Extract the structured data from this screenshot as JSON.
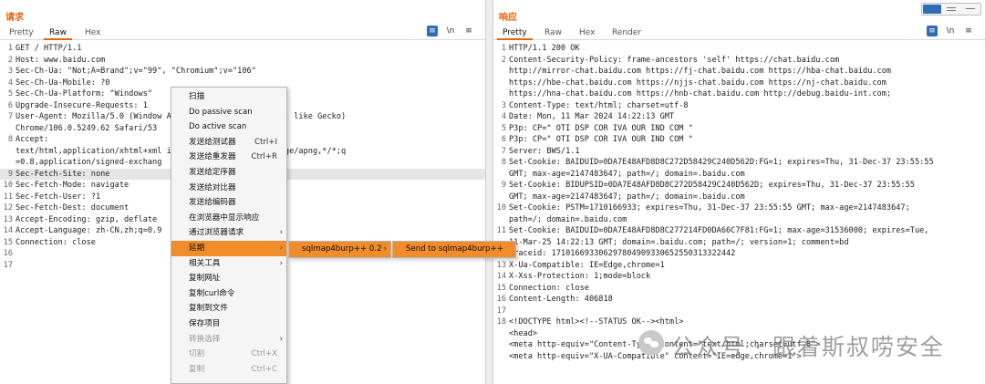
{
  "request": {
    "title": "请求",
    "tabs": [
      "Pretty",
      "Raw",
      "Hex"
    ],
    "active_tab": "Raw",
    "icons": [
      "wrap-icon",
      "newline-icon",
      "menu-icon"
    ],
    "icon_glyphs": [
      "≡",
      "\\n",
      "≡"
    ],
    "lines": [
      [
        "1",
        "GET / HTTP/1.1"
      ],
      [
        "2",
        "Host: www.baidu.com"
      ],
      [
        "3",
        "Sec-Ch-Ua: \"Not;A=Brand\";v=\"99\", \"Chromium\";v=\"106\""
      ],
      [
        "4",
        "Sec-Ch-Ua-Mobile: ?0"
      ],
      [
        "5",
        "Sec-Ch-Ua-Platform: \"Windows\""
      ],
      [
        "6",
        "Upgrade-Insecure-Requests: 1"
      ],
      [
        "7",
        "User-Agent: Mozilla/5.0 (Window                      AppleWebKit/537.36 (KHTML, like Gecko)"
      ],
      [
        "",
        " Chrome/106.0.5249.62 Safari/53"
      ],
      [
        "8",
        "Accept:"
      ],
      [
        "",
        "text/html,application/xhtml+xml                       image/avif,image/webp,image/apng,*/*;q"
      ],
      [
        "",
        "=0.8,application/signed-exchang"
      ],
      [
        "9",
        "Sec-Fetch-Site: none"
      ],
      [
        "10",
        "Sec-Fetch-Mode: navigate"
      ],
      [
        "11",
        "Sec-Fetch-User: ?1"
      ],
      [
        "12",
        "Sec-Fetch-Dest: document"
      ],
      [
        "13",
        "Accept-Encoding: gzip, deflate"
      ],
      [
        "14",
        "Accept-Language: zh-CN,zh;q=0.9"
      ],
      [
        "15",
        "Connection: close"
      ],
      [
        "16",
        ""
      ],
      [
        "17",
        ""
      ]
    ]
  },
  "response": {
    "title": "响应",
    "tabs": [
      "Pretty",
      "Raw",
      "Hex",
      "Render"
    ],
    "active_tab": "Pretty",
    "icon_glyphs": [
      "≡",
      "\\n",
      "≡"
    ],
    "lines": [
      [
        "1",
        "HTTP/1.1 200 OK"
      ],
      [
        "2",
        "Content-Security-Policy: frame-ancestors 'self' https://chat.baidu.com"
      ],
      [
        "",
        "http://mirror-chat.baidu.com https://fj-chat.baidu.com https://hba-chat.baidu.com"
      ],
      [
        "",
        "https://hbe-chat.baidu.com https://njjs-chat.baidu.com https://nj-chat.baidu.com"
      ],
      [
        "",
        "https://hna-chat.baidu.com https://hnb-chat.baidu.com http://debug.baidu-int.com;"
      ],
      [
        "3",
        "Content-Type: text/html; charset=utf-8"
      ],
      [
        "4",
        "Date: Mon, 11 Mar 2024 14:22:13 GMT"
      ],
      [
        "5",
        "P3p: CP=\" OTI DSP COR IVA OUR IND COM \""
      ],
      [
        "6",
        "P3p: CP=\" OTI DSP COR IVA OUR IND COM \""
      ],
      [
        "7",
        "Server: BWS/1.1"
      ],
      [
        "8",
        "Set-Cookie: BAIDUID=0DA7E48AFD8D8C272D58429C240D562D:FG=1; expires=Thu, 31-Dec-37 23:55:55"
      ],
      [
        "",
        "GMT; max-age=2147483647; path=/; domain=.baidu.com"
      ],
      [
        "9",
        "Set-Cookie: BIDUPSID=0DA7E48AFD8D8C272D58429C240D562D; expires=Thu, 31-Dec-37 23:55:55"
      ],
      [
        "",
        "GMT; max-age=2147483647; path=/; domain=.baidu.com"
      ],
      [
        "10",
        "Set-Cookie: PSTM=1710166933; expires=Thu, 31-Dec-37 23:55:55 GMT; max-age=2147483647;"
      ],
      [
        "",
        "path=/; domain=.baidu.com"
      ],
      [
        "11",
        "Set-Cookie: BAIDUID=0DA7E48AFD8D8C277214FD0DA66C7F81:FG=1; max-age=31536000; expires=Tue,"
      ],
      [
        "",
        "11-Mar-25 14:22:13 GMT; domain=.baidu.com; path=/; version=1; comment=bd"
      ],
      [
        "12",
        "Traceid: 1710166933062978049093306525503133224​42"
      ],
      [
        "13",
        "X-Ua-Compatible: IE=Edge,chrome=1"
      ],
      [
        "14",
        "X-Xss-Protection: 1;mode=block"
      ],
      [
        "15",
        "Connection: close"
      ],
      [
        "16",
        "Content-Length: 406818"
      ],
      [
        "17",
        ""
      ],
      [
        "18",
        "<!DOCTYPE html><!--STATUS OK--><html>"
      ],
      [
        "",
        "  <head>"
      ],
      [
        "",
        "    <meta http-equiv=\"Content-Type\" content=\"text/html;charset=utf-8\">"
      ],
      [
        "",
        "    <meta http-equiv=\"X-UA-Compatible\" content=\"IE=edge,chrome=1\">"
      ]
    ]
  },
  "context_menu": {
    "items": [
      {
        "label": "扫描",
        "shortcut": "",
        "submenu": false,
        "state": "normal"
      },
      {
        "label": "Do passive scan",
        "shortcut": "",
        "submenu": false,
        "state": "normal"
      },
      {
        "label": "Do active scan",
        "shortcut": "",
        "submenu": false,
        "state": "normal"
      },
      {
        "label": "发送给测试器",
        "shortcut": "Ctrl+I",
        "submenu": false,
        "state": "normal"
      },
      {
        "label": "发送给重发器",
        "shortcut": "Ctrl+R",
        "submenu": false,
        "state": "normal"
      },
      {
        "label": "发送给定序器",
        "shortcut": "",
        "submenu": false,
        "state": "normal"
      },
      {
        "label": "发送给对比器",
        "shortcut": "",
        "submenu": false,
        "state": "normal"
      },
      {
        "label": "发送给编码器",
        "shortcut": "",
        "submenu": false,
        "state": "normal"
      },
      {
        "label": "在浏览器中显示响应",
        "shortcut": "",
        "submenu": false,
        "state": "normal"
      },
      {
        "label": "通过浏览器请求",
        "shortcut": "",
        "submenu": true,
        "state": "normal"
      },
      {
        "label": "延期",
        "shortcut": "",
        "submenu": true,
        "state": "active"
      },
      {
        "label": "相关工具",
        "shortcut": "",
        "submenu": true,
        "state": "normal"
      },
      {
        "label": "复制网址",
        "shortcut": "",
        "submenu": false,
        "state": "normal"
      },
      {
        "label": "复制curl命令",
        "shortcut": "",
        "submenu": false,
        "state": "normal"
      },
      {
        "label": "复制到文件",
        "shortcut": "",
        "submenu": false,
        "state": "normal"
      },
      {
        "label": "保存项目",
        "shortcut": "",
        "submenu": false,
        "state": "normal"
      },
      {
        "label": "转换选择",
        "shortcut": "",
        "submenu": true,
        "state": "disabled"
      },
      {
        "label": "切割",
        "shortcut": "Ctrl+X",
        "submenu": false,
        "state": "disabled"
      },
      {
        "label": "复制",
        "shortcut": "Ctrl+C",
        "submenu": false,
        "state": "disabled"
      }
    ],
    "submenu_extension": "sqlmap4burp++ 0.2",
    "submenu_action": "Send to sqlmap4burp++",
    "arrow": "›",
    "active_color": "#f08c2a"
  },
  "watermark": {
    "text": "公众号 · 跟着斯叔唠安全"
  },
  "colors": {
    "accent": "#e8620f",
    "selected_blue": "#2e6db5"
  }
}
